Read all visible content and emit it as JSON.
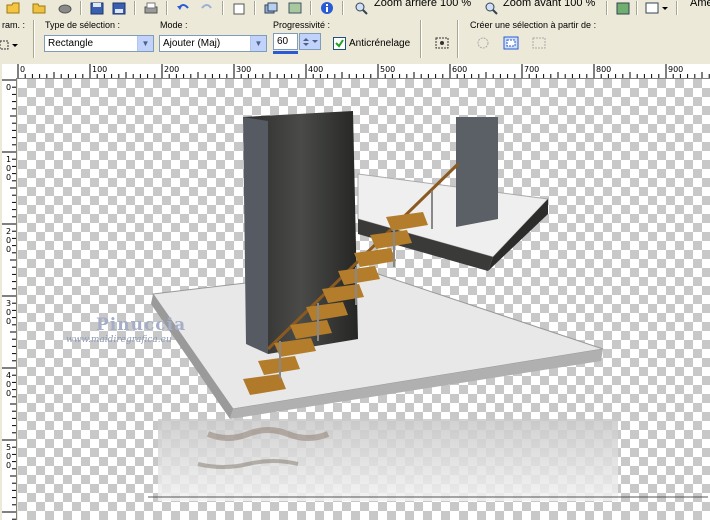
{
  "toolbar": {
    "zoom_out_label": "Zoom arrière 100 %",
    "zoom_in_label": "Zoom avant 100 %",
    "cut_label": "Ame"
  },
  "options": {
    "params_label": "ram. :",
    "selection_type_label": "Type de sélection :",
    "selection_type_value": "Rectangle",
    "mode_label": "Mode :",
    "mode_value": "Ajouter (Maj)",
    "feather_label": "Progressivité :",
    "feather_value": "60",
    "antialias_label": "Anticrénelage",
    "antialias_checked": true,
    "create_from_label": "Créer une sélection à partir de :"
  },
  "ruler": {
    "h_labels": [
      "0",
      "100",
      "200",
      "300",
      "400",
      "500",
      "600",
      "700",
      "800",
      "900"
    ],
    "v_labels": [
      "0",
      "100",
      "200",
      "300",
      "400",
      "500"
    ]
  },
  "watermark": {
    "name": "Pinuccia",
    "url": "www.maidiregrafica.eu"
  }
}
